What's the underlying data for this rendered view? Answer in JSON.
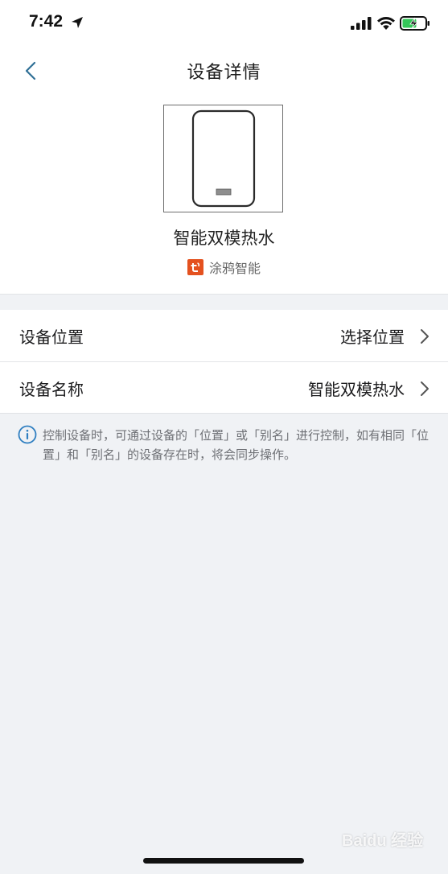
{
  "status_bar": {
    "time": "7:42"
  },
  "nav": {
    "title": "设备详情"
  },
  "device": {
    "name": "智能双模热水",
    "brand": "涂鸦智能"
  },
  "settings": [
    {
      "label": "设备位置",
      "value": "选择位置"
    },
    {
      "label": "设备名称",
      "value": "智能双模热水"
    }
  ],
  "note": {
    "text": "控制设备时，可通过设备的「位置」或「别名」进行控制，如有相同「位置」和「别名」的设备存在时，将会同步操作。"
  },
  "watermark": {
    "text": "Baidu 经验"
  },
  "colors": {
    "brand_logo": "#e4511f",
    "info_accent": "#2f7fc1",
    "page_background": "#f0f2f5"
  }
}
